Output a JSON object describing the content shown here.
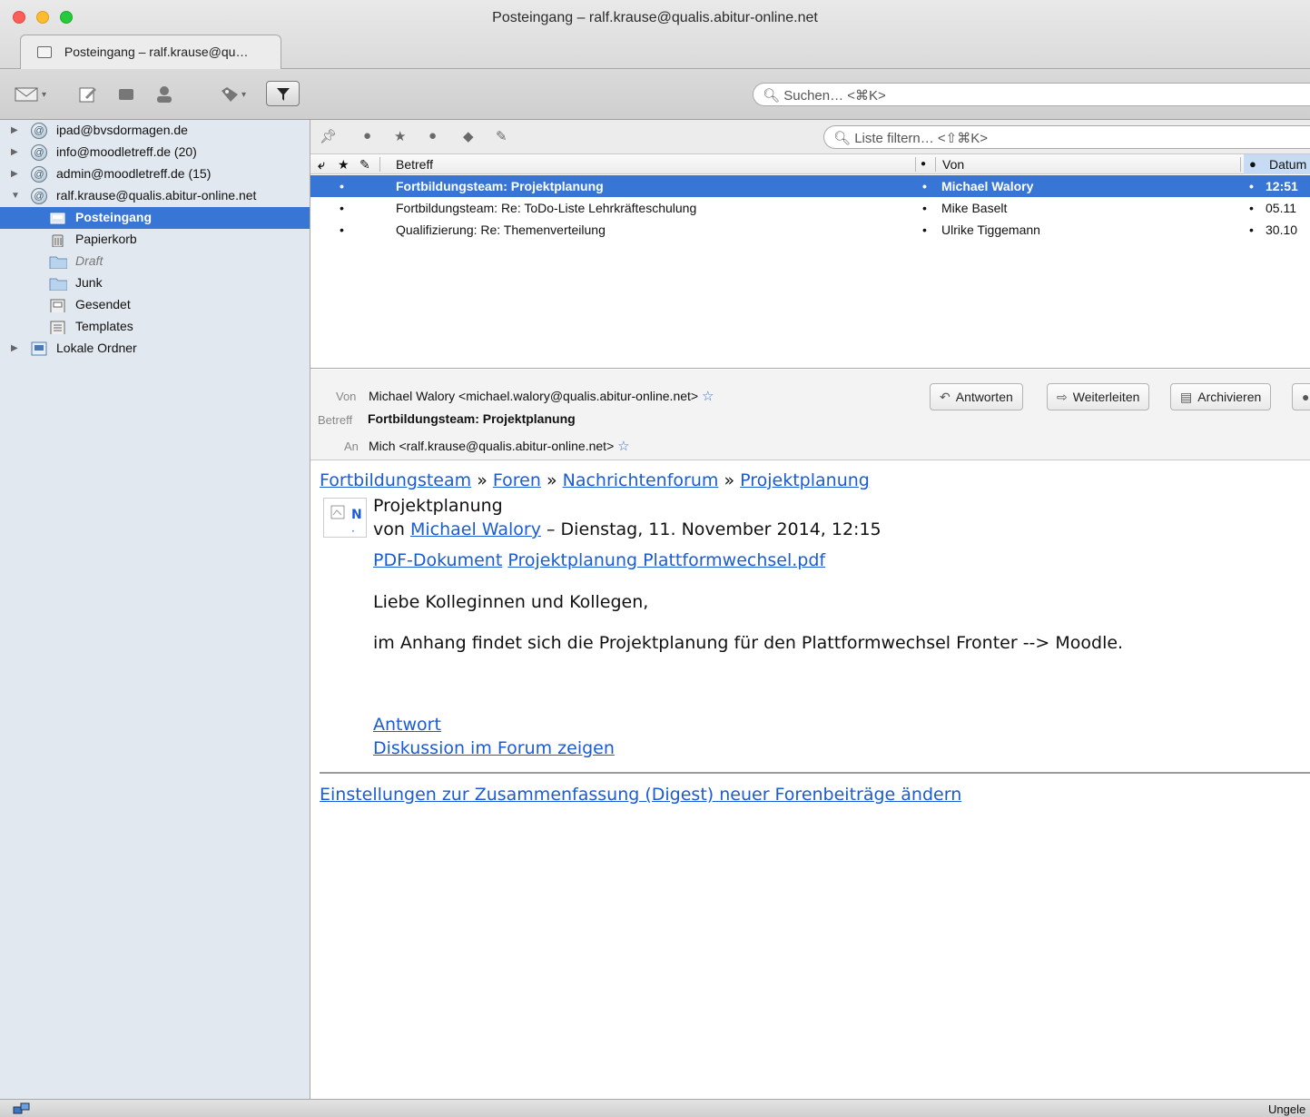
{
  "window": {
    "title": "Posteingang – ralf.krause@qualis.abitur-online.net",
    "tab_label": "Posteingang – ralf.krause@qu…"
  },
  "toolbar": {
    "search_placeholder": "Suchen… <⌘K>"
  },
  "sidebar": {
    "accounts": [
      {
        "label": "ipad@bvsdormagen.de",
        "expanded": false
      },
      {
        "label": "info@moodletreff.de (20)",
        "expanded": false
      },
      {
        "label": "admin@moodletreff.de (15)",
        "expanded": false
      },
      {
        "label": "ralf.krause@qualis.abitur-online.net",
        "expanded": true
      }
    ],
    "folders": [
      {
        "label": "Posteingang",
        "icon": "inbox-icon",
        "selected": true
      },
      {
        "label": "Papierkorb",
        "icon": "trash-icon"
      },
      {
        "label": "Draft",
        "icon": "folder-icon"
      },
      {
        "label": "Junk",
        "icon": "folder-icon"
      },
      {
        "label": "Gesendet",
        "icon": "sent-icon"
      },
      {
        "label": "Templates",
        "icon": "templates-icon"
      }
    ],
    "local_folders": "Lokale Ordner"
  },
  "message_list": {
    "filter_placeholder": "Liste filtern… <⇧⌘K>",
    "columns": {
      "subject": "Betreff",
      "from": "Von",
      "date": "Datum"
    },
    "rows": [
      {
        "subject": "Fortbildungsteam: Projektplanung",
        "from": "Michael Walory",
        "date": "12:51",
        "selected": true
      },
      {
        "subject": "Fortbildungsteam: Re: ToDo-Liste Lehrkräfteschulung",
        "from": "Mike Baselt",
        "date": "05.11"
      },
      {
        "subject": "Qualifizierung: Re: Themenverteilung",
        "from": "Ulrike Tiggemann",
        "date": "30.10"
      }
    ]
  },
  "message_header": {
    "from_label": "Von",
    "from_value": "Michael Walory <michael.walory@qualis.abitur-online.net>",
    "subject_label": "Betreff",
    "subject_value": "Fortbildungsteam: Projektplanung",
    "to_label": "An",
    "to_value": "Mich <ralf.krause@qualis.abitur-online.net>",
    "buttons": {
      "reply": "Antworten",
      "forward": "Weiterleiten",
      "archive": "Archivieren"
    }
  },
  "message_body": {
    "breadcrumb": [
      "Fortbildungsteam",
      "Foren",
      "Nachrichtenforum",
      "Projektplanung"
    ],
    "breadcrumb_sep": "»",
    "post_title": "Projektplanung",
    "by_prefix": "von",
    "author": "Michael Walory",
    "post_date": "– Dienstag, 11. November 2014, 12:15",
    "attachment_type": "PDF-Dokument",
    "attachment_name": "Projektplanung Plattformwechsel.pdf",
    "greeting": "Liebe Kolleginnen und Kollegen,",
    "text": "im Anhang findet sich die Projektplanung für den Plattformwechsel Fronter --> Moodle.",
    "reply_link": "Antwort",
    "discussion_link": "Diskussion im Forum zeigen",
    "digest_link": "Einstellungen zur Zusammenfassung (Digest) neuer Forenbeiträge ändern"
  },
  "statusbar": {
    "right_text": "Ungele"
  }
}
